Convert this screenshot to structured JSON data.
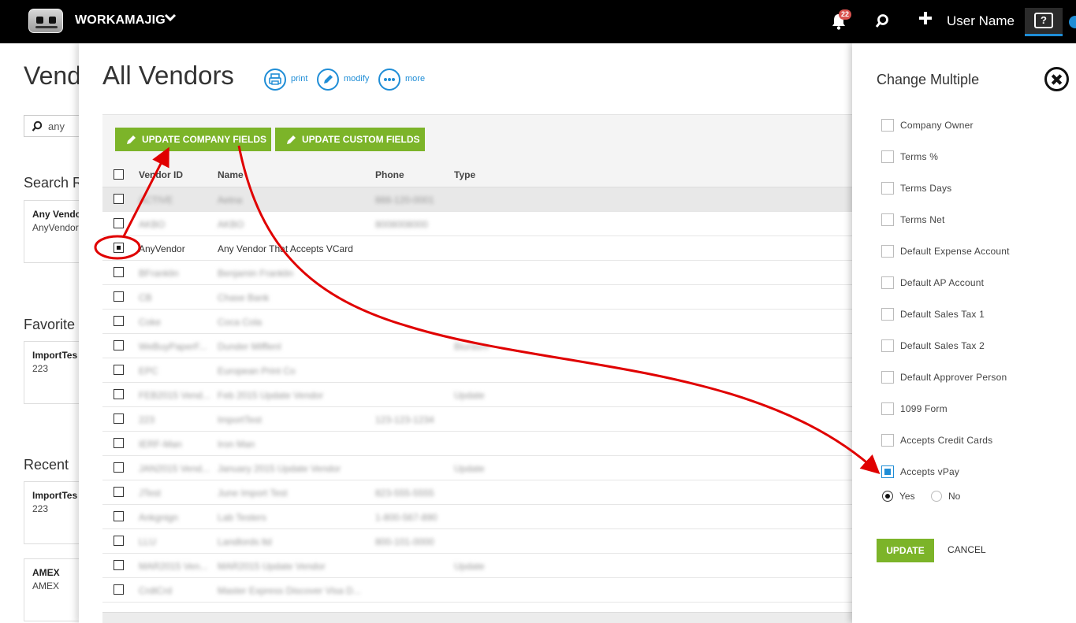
{
  "topbar": {
    "app_name": "WORKAMAJIG",
    "notification_count": "22",
    "user_name": "User Name",
    "help_label": "?"
  },
  "background_page": {
    "title": "Vend",
    "search_value": "any",
    "sections": [
      {
        "label": "Search R",
        "card_title": "Any Vendor",
        "card_sub": "AnyVendor"
      },
      {
        "label": "Favorite",
        "card_title": "ImportTes",
        "card_sub": "223"
      },
      {
        "label": "Recent",
        "card_title": "ImportTes",
        "card_sub": "223"
      },
      {
        "label": "",
        "card_title": "AMEX",
        "card_sub": "AMEX"
      }
    ]
  },
  "main": {
    "title": "All Vendors",
    "tools": {
      "print": "print",
      "modify": "modify",
      "more": "more"
    },
    "buttons": {
      "company": "UPDATE COMPANY FIELDS",
      "custom": "UPDATE CUSTOM FIELDS"
    },
    "columns": [
      "Vendor ID",
      "Name",
      "Phone",
      "Type"
    ],
    "rows": [
      {
        "id": "ACTIVE",
        "name": "Aetna",
        "phone": "888-120-0001",
        "type": "",
        "checked": false,
        "blurred": true
      },
      {
        "id": "AKBO",
        "name": "AKBO",
        "phone": "8008008000",
        "type": "",
        "checked": false,
        "blurred": true
      },
      {
        "id": "AnyVendor",
        "name": "Any Vendor That Accepts VCard",
        "phone": "",
        "type": "",
        "checked": true,
        "blurred": false
      },
      {
        "id": "BFranklin",
        "name": "Benjamin Franklin",
        "phone": "",
        "type": "",
        "checked": false,
        "blurred": true
      },
      {
        "id": "CB",
        "name": "Chase Bank",
        "phone": "",
        "type": "",
        "checked": false,
        "blurred": true
      },
      {
        "id": "Coke",
        "name": "Coca Cola",
        "phone": "",
        "type": "",
        "checked": false,
        "blurred": true
      },
      {
        "id": "WeBuyPaperF...",
        "name": "Dunder Mifflenl",
        "phone": "",
        "type": "Biurasm",
        "checked": false,
        "blurred": true
      },
      {
        "id": "EPC",
        "name": "European Print Co",
        "phone": "",
        "type": "",
        "checked": false,
        "blurred": true
      },
      {
        "id": "FEB2015 Vend...",
        "name": "Feb 2015 Update Vendor",
        "phone": "",
        "type": "Update",
        "checked": false,
        "blurred": true
      },
      {
        "id": "223",
        "name": "ImportTest",
        "phone": "123-123-1234",
        "type": "",
        "checked": false,
        "blurred": true
      },
      {
        "id": "IERF-Man",
        "name": "Iron Man",
        "phone": "",
        "type": "",
        "checked": false,
        "blurred": true
      },
      {
        "id": "JAN2015 Vend...",
        "name": "January 2015 Update Vendor",
        "phone": "",
        "type": "Update",
        "checked": false,
        "blurred": true
      },
      {
        "id": "JTest",
        "name": "June Import Test",
        "phone": "823-555-5555",
        "type": "",
        "checked": false,
        "blurred": true
      },
      {
        "id": "Ankgnign",
        "name": "Lab Testers",
        "phone": "1-800-567-890",
        "type": "",
        "checked": false,
        "blurred": true
      },
      {
        "id": "LLU",
        "name": "Landlords ltd",
        "phone": "800-101-0000",
        "type": "",
        "checked": false,
        "blurred": true
      },
      {
        "id": "MAR2015 Ven...",
        "name": "MAR2015 Update Vendor",
        "phone": "",
        "type": "Update",
        "checked": false,
        "blurred": true
      },
      {
        "id": "CrdtCrd",
        "name": "Master Express Discover Visa D...",
        "phone": "",
        "type": "",
        "checked": false,
        "blurred": true
      }
    ]
  },
  "side": {
    "title": "Change Multiple",
    "options": [
      {
        "label": "Company Owner",
        "checked": false
      },
      {
        "label": "Terms %",
        "checked": false
      },
      {
        "label": "Terms Days",
        "checked": false
      },
      {
        "label": "Terms Net",
        "checked": false
      },
      {
        "label": "Default Expense Account",
        "checked": false
      },
      {
        "label": "Default AP Account",
        "checked": false
      },
      {
        "label": "Default Sales Tax 1",
        "checked": false
      },
      {
        "label": "Default Sales Tax 2",
        "checked": false
      },
      {
        "label": "Default Approver Person",
        "checked": false
      },
      {
        "label": "1099 Form",
        "checked": false
      },
      {
        "label": "Accepts Credit Cards",
        "checked": false
      },
      {
        "label": "Accepts vPay",
        "checked": true
      }
    ],
    "radio_yes": "Yes",
    "radio_no": "No",
    "radio_selected": "Yes",
    "update_label": "UPDATE",
    "cancel_label": "CANCEL"
  },
  "colors": {
    "accent_blue": "#1f8dd6",
    "button_green": "#7cb429",
    "annotation_red": "#e00000"
  }
}
